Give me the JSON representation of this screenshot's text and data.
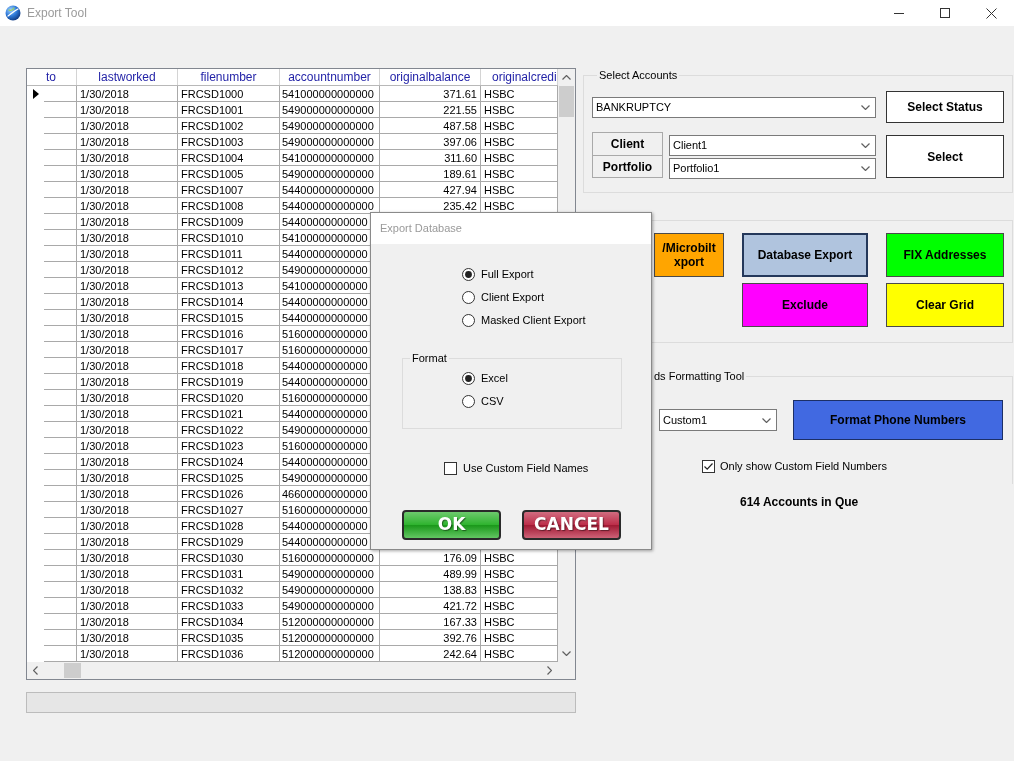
{
  "window": {
    "title": "Export Tool"
  },
  "grid": {
    "columns": [
      "to",
      "lastworked",
      "filenumber",
      "accountnumber",
      "originalbalance",
      "originalcredi"
    ],
    "rows": [
      {
        "current": true,
        "cells": [
          "",
          "1/30/2018",
          "FRCSD1000",
          "541000000000000",
          "371.61",
          "HSBC"
        ]
      },
      {
        "current": false,
        "cells": [
          "",
          "1/30/2018",
          "FRCSD1001",
          "549000000000000",
          "221.55",
          "HSBC"
        ]
      },
      {
        "current": false,
        "cells": [
          "",
          "1/30/2018",
          "FRCSD1002",
          "549000000000000",
          "487.58",
          "HSBC"
        ]
      },
      {
        "current": false,
        "cells": [
          "",
          "1/30/2018",
          "FRCSD1003",
          "549000000000000",
          "397.06",
          "HSBC"
        ]
      },
      {
        "current": false,
        "cells": [
          "",
          "1/30/2018",
          "FRCSD1004",
          "541000000000000",
          "311.60",
          "HSBC"
        ]
      },
      {
        "current": false,
        "cells": [
          "",
          "1/30/2018",
          "FRCSD1005",
          "549000000000000",
          "189.61",
          "HSBC"
        ]
      },
      {
        "current": false,
        "cells": [
          "",
          "1/30/2018",
          "FRCSD1007",
          "544000000000000",
          "427.94",
          "HSBC"
        ]
      },
      {
        "current": false,
        "cells": [
          "",
          "1/30/2018",
          "FRCSD1008",
          "544000000000000",
          "235.42",
          "HSBC"
        ]
      },
      {
        "current": false,
        "cells": [
          "",
          "1/30/2018",
          "FRCSD1009",
          "54400000000000"
        ]
      },
      {
        "current": false,
        "cells": [
          "",
          "1/30/2018",
          "FRCSD1010",
          "54100000000000"
        ]
      },
      {
        "current": false,
        "cells": [
          "",
          "1/30/2018",
          "FRCSD1011",
          "54400000000000"
        ]
      },
      {
        "current": false,
        "cells": [
          "",
          "1/30/2018",
          "FRCSD1012",
          "54900000000000"
        ]
      },
      {
        "current": false,
        "cells": [
          "",
          "1/30/2018",
          "FRCSD1013",
          "54100000000000"
        ]
      },
      {
        "current": false,
        "cells": [
          "",
          "1/30/2018",
          "FRCSD1014",
          "54400000000000"
        ]
      },
      {
        "current": false,
        "cells": [
          "",
          "1/30/2018",
          "FRCSD1015",
          "54400000000000"
        ]
      },
      {
        "current": false,
        "cells": [
          "",
          "1/30/2018",
          "FRCSD1016",
          "51600000000000"
        ]
      },
      {
        "current": false,
        "cells": [
          "",
          "1/30/2018",
          "FRCSD1017",
          "51600000000000"
        ]
      },
      {
        "current": false,
        "cells": [
          "",
          "1/30/2018",
          "FRCSD1018",
          "54400000000000"
        ]
      },
      {
        "current": false,
        "cells": [
          "",
          "1/30/2018",
          "FRCSD1019",
          "54400000000000"
        ]
      },
      {
        "current": false,
        "cells": [
          "",
          "1/30/2018",
          "FRCSD1020",
          "51600000000000"
        ]
      },
      {
        "current": false,
        "cells": [
          "",
          "1/30/2018",
          "FRCSD1021",
          "54400000000000"
        ]
      },
      {
        "current": false,
        "cells": [
          "",
          "1/30/2018",
          "FRCSD1022",
          "54900000000000"
        ]
      },
      {
        "current": false,
        "cells": [
          "",
          "1/30/2018",
          "FRCSD1023",
          "51600000000000"
        ]
      },
      {
        "current": false,
        "cells": [
          "",
          "1/30/2018",
          "FRCSD1024",
          "54400000000000"
        ]
      },
      {
        "current": false,
        "cells": [
          "",
          "1/30/2018",
          "FRCSD1025",
          "54900000000000"
        ]
      },
      {
        "current": false,
        "cells": [
          "",
          "1/30/2018",
          "FRCSD1026",
          "46600000000000"
        ]
      },
      {
        "current": false,
        "cells": [
          "",
          "1/30/2018",
          "FRCSD1027",
          "51600000000000"
        ]
      },
      {
        "current": false,
        "cells": [
          "",
          "1/30/2018",
          "FRCSD1028",
          "54400000000000"
        ]
      },
      {
        "current": false,
        "cells": [
          "",
          "1/30/2018",
          "FRCSD1029",
          "54400000000000"
        ]
      },
      {
        "current": false,
        "cells": [
          "",
          "1/30/2018",
          "FRCSD1030",
          "516000000000000",
          "176.09",
          "HSBC"
        ]
      },
      {
        "current": false,
        "cells": [
          "",
          "1/30/2018",
          "FRCSD1031",
          "549000000000000",
          "489.99",
          "HSBC"
        ]
      },
      {
        "current": false,
        "cells": [
          "",
          "1/30/2018",
          "FRCSD1032",
          "549000000000000",
          "138.83",
          "HSBC"
        ]
      },
      {
        "current": false,
        "cells": [
          "",
          "1/30/2018",
          "FRCSD1033",
          "549000000000000",
          "421.72",
          "HSBC"
        ]
      },
      {
        "current": false,
        "cells": [
          "",
          "1/30/2018",
          "FRCSD1034",
          "512000000000000",
          "167.33",
          "HSBC"
        ]
      },
      {
        "current": false,
        "cells": [
          "",
          "1/30/2018",
          "FRCSD1035",
          "512000000000000",
          "392.76",
          "HSBC"
        ]
      },
      {
        "current": false,
        "cells": [
          "",
          "1/30/2018",
          "FRCSD1036",
          "512000000000000",
          "242.64",
          "HSBC"
        ]
      }
    ]
  },
  "progress_bar": {
    "level": 0
  },
  "select_accounts": {
    "title": "Select Accounts",
    "status": {
      "value": "BANKRUPTCY"
    },
    "select_status_button": "Select Status",
    "client": {
      "label": "Client",
      "value": "Client1"
    },
    "portfolio": {
      "label": "Portfolio",
      "value": "Portfolio1"
    },
    "select_button": "Select"
  },
  "actions": {
    "rows": [
      {
        "buttons": [
          {
            "lines": [
              "/Microbilt",
              "xport"
            ],
            "color": "#ffa500",
            "focused": false
          },
          {
            "lines": [
              "Database Export"
            ],
            "color": "#b0c4de",
            "focused": true
          },
          {
            "lines": [
              "FIX Addresses"
            ],
            "color": "#00ff00",
            "focused": false
          }
        ]
      },
      {
        "buttons": [
          {
            "lines": [
              "Exclude"
            ],
            "color": "#ff00ff",
            "focused": false
          },
          {
            "lines": [
              "Clear Grid"
            ],
            "color": "#ffff00",
            "focused": false
          }
        ]
      }
    ]
  },
  "formatting": {
    "title": "ds Formatting Tool",
    "field": {
      "value": "Custom1"
    },
    "format_button": "Format Phone Numbers",
    "only_custom": {
      "label": "Only show Custom Field Numbers",
      "checked": true
    }
  },
  "queue_count": "614 Accounts in Que",
  "dialog": {
    "title": "Export Database",
    "export_types": [
      {
        "label": "Full Export",
        "selected": true
      },
      {
        "label": "Client Export",
        "selected": false
      },
      {
        "label": "Masked Client Export",
        "selected": false
      }
    ],
    "format": {
      "title": "Format",
      "options": [
        {
          "label": "Excel",
          "selected": true
        },
        {
          "label": "CSV",
          "selected": false
        }
      ]
    },
    "custom_names": {
      "label": "Use Custom Field Names",
      "checked": false
    },
    "buttons": [
      {
        "label": "OK",
        "color": "#1fae1f"
      },
      {
        "label": "CANCEL",
        "color": "#b81e3c"
      }
    ]
  }
}
